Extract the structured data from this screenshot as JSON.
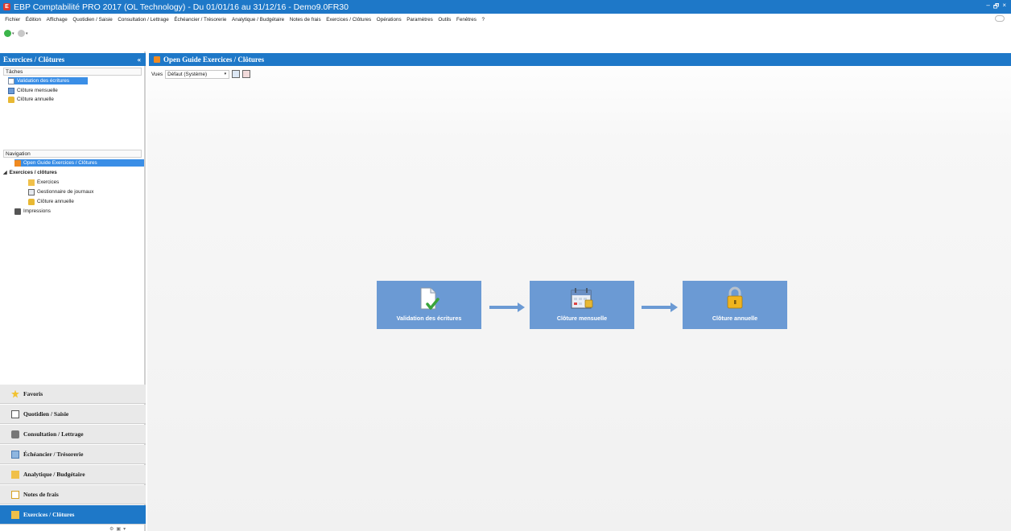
{
  "window": {
    "title": "EBP Comptabilité PRO 2017 (OL Technology) - Du 01/01/16 au 31/12/16 - Demo9.0FR30",
    "controls": {
      "minimize": "–",
      "restore": "🗗",
      "close": "×"
    }
  },
  "menu": [
    "Fichier",
    "Édition",
    "Affichage",
    "Quotidien / Saisie",
    "Consultation / Lettrage",
    "Échéancier / Trésorerie",
    "Analytique / Budgétaire",
    "Notes de frais",
    "Exercices / Clôtures",
    "Opérations",
    "Paramètres",
    "Outils",
    "Fenêtres",
    "?"
  ],
  "left_panel": {
    "title": "Exercices / Clôtures",
    "collapse_label": "«",
    "tasks_title": "Tâches",
    "tasks": [
      {
        "label": "Validation des écritures",
        "icon": "validation-icon",
        "selected": true
      },
      {
        "label": "Clôture mensuelle",
        "icon": "calendar-icon",
        "selected": false
      },
      {
        "label": "Clôture annuelle",
        "icon": "lock-icon",
        "selected": false
      }
    ],
    "navigation_title": "Navigation",
    "navigation": {
      "guide": "Open Guide Exercices / Clôtures",
      "group": "Exercices / clôtures",
      "group_arrow": "◢",
      "children": [
        "Exercices",
        "Gestionnaire de journaux",
        "Clôture annuelle"
      ],
      "impressions": "Impressions"
    },
    "nav_buttons": [
      {
        "label": "Favoris",
        "active": false,
        "icon": "star-icon"
      },
      {
        "label": "Quotidien / Saisie",
        "active": false,
        "icon": "book-icon"
      },
      {
        "label": "Consultation / Lettrage",
        "active": false,
        "icon": "binoculars-icon"
      },
      {
        "label": "Échéancier / Trésorerie",
        "active": false,
        "icon": "schedule-icon"
      },
      {
        "label": "Analytique / Budgétaire",
        "active": false,
        "icon": "analytics-icon"
      },
      {
        "label": "Notes de frais",
        "active": false,
        "icon": "receipt-icon"
      },
      {
        "label": "Exercices / Clôtures",
        "active": true,
        "icon": "closing-icon"
      }
    ]
  },
  "main": {
    "title": "Open Guide Exercices / Clôtures",
    "views_label": "Vues",
    "views_value": "Défaut (Système)",
    "steps": [
      {
        "label": "Validation des écritures",
        "icon": "validation-icon"
      },
      {
        "label": "Clôture mensuelle",
        "icon": "calendar-icon"
      },
      {
        "label": "Clôture annuelle",
        "icon": "lock-icon"
      }
    ]
  },
  "colors": {
    "accent": "#1e78c8",
    "step": "#6b9ad4",
    "selected": "#3a8ee6"
  }
}
